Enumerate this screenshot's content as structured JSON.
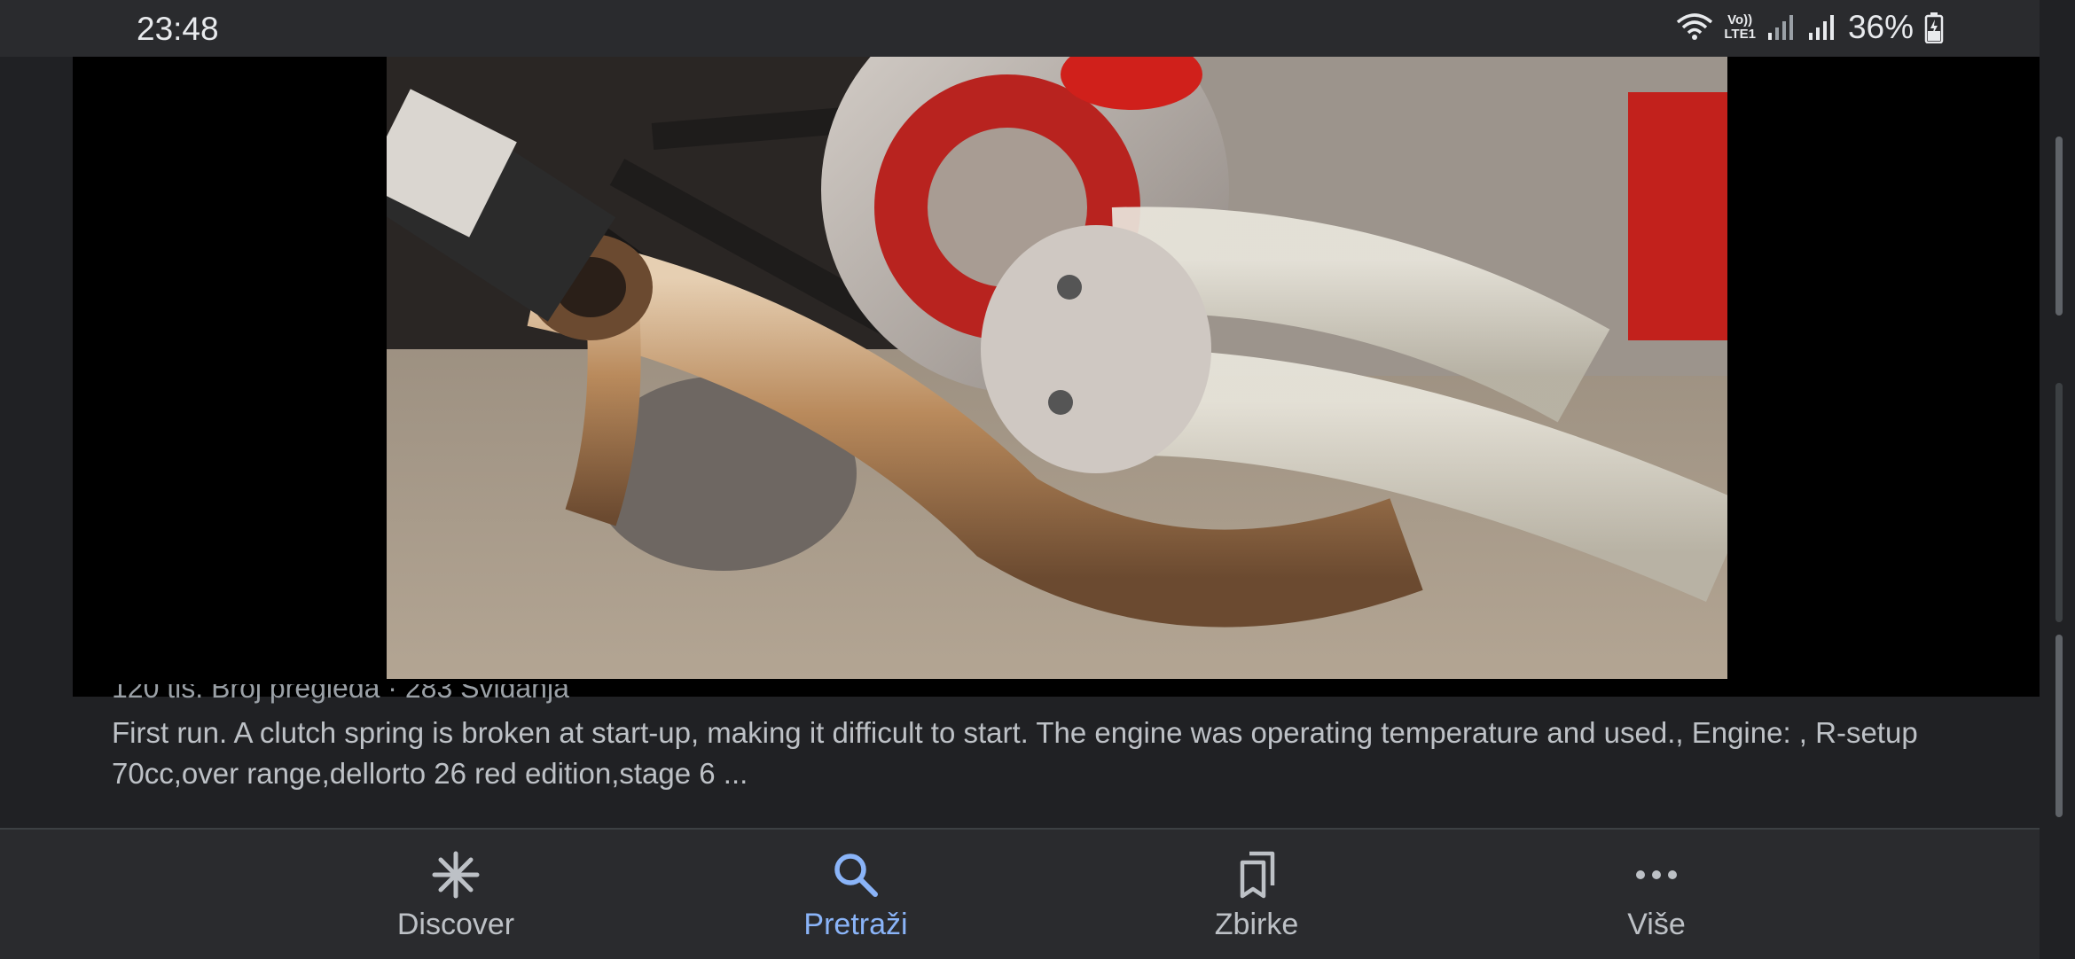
{
  "status_bar": {
    "time": "23:48",
    "network_label_top": "Vo))",
    "network_label_bottom": "LTE1",
    "battery_percent": "36%",
    "icons": [
      "wifi-icon",
      "signal-icon",
      "signal-icon",
      "battery-charging-icon"
    ]
  },
  "video": {
    "meta_line": "120 tis. Broj pregleda · 283 Sviđanja",
    "description": "First run. A clutch spring is broken at start-up, making it difficult to start. The engine was operating temperature and used., Engine: , R-setup 70cc,over range,dellorto 26 red edition,stage 6 ..."
  },
  "bottom_nav": {
    "items": [
      {
        "label": "Discover",
        "icon": "asterisk-icon",
        "active": false
      },
      {
        "label": "Pretraži",
        "icon": "search-icon",
        "active": true
      },
      {
        "label": "Zbirke",
        "icon": "bookmarks-icon",
        "active": false
      },
      {
        "label": "Više",
        "icon": "more-dots-icon",
        "active": false
      }
    ]
  },
  "colors": {
    "background": "#202124",
    "active_accent": "#8ab4f8",
    "inactive_text": "#bdc1c6"
  }
}
